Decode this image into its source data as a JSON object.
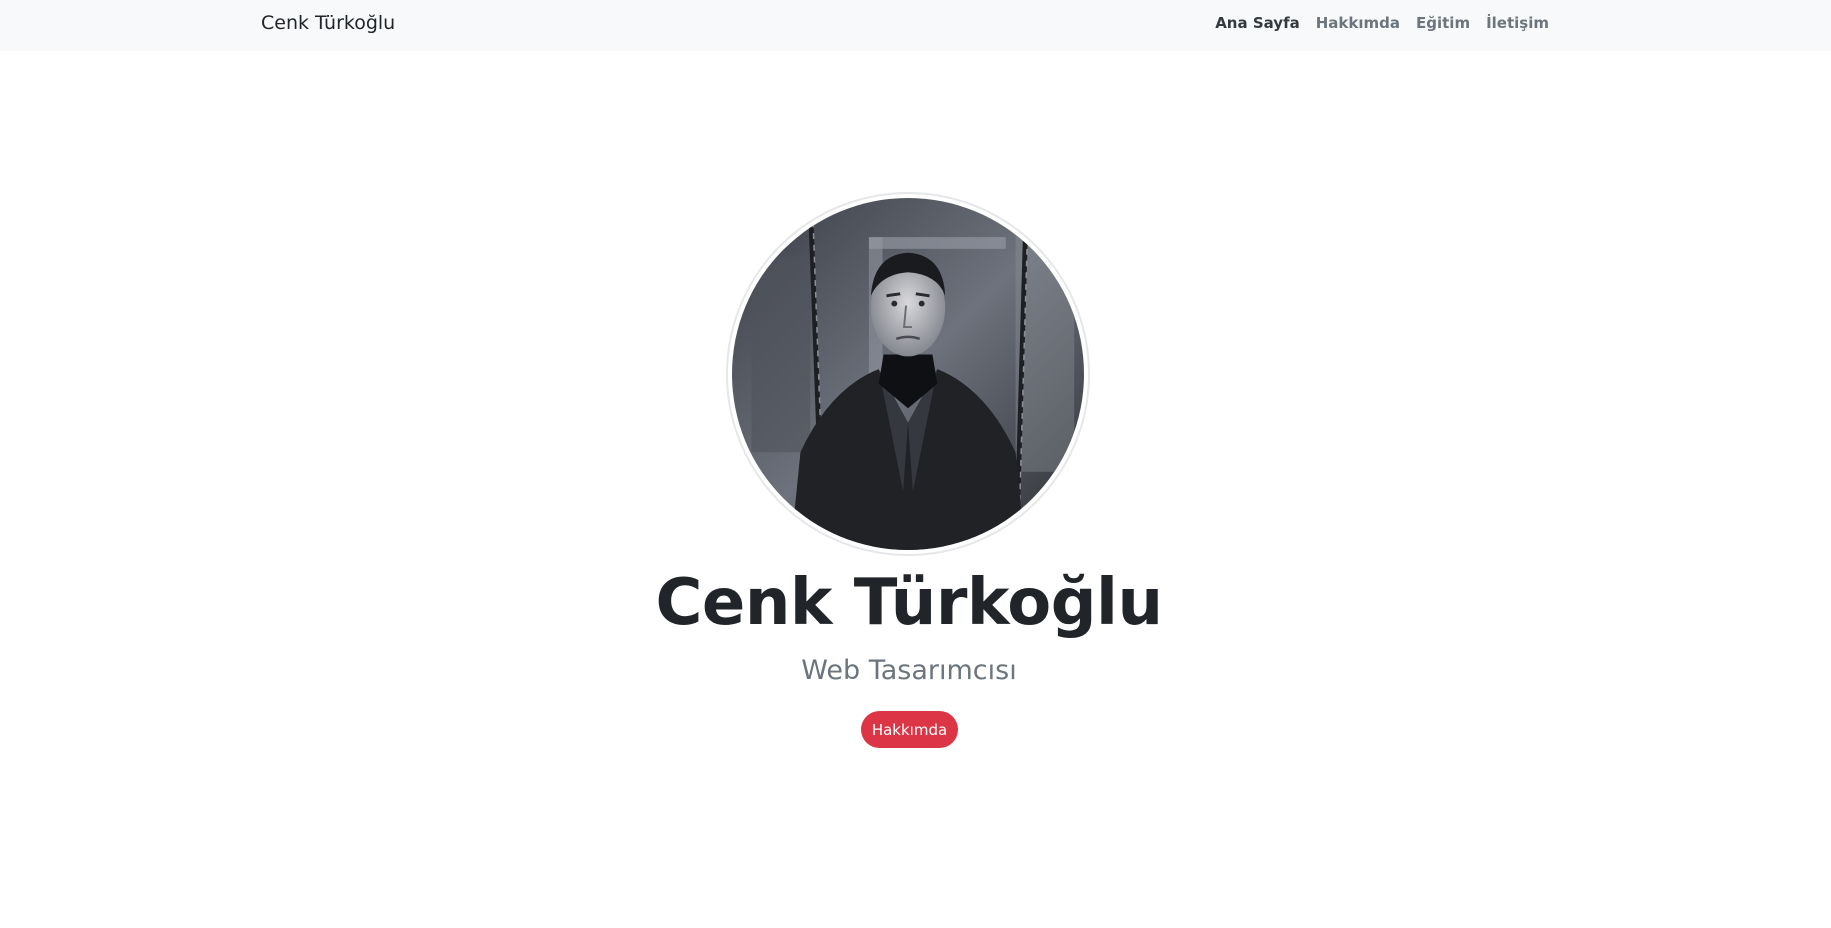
{
  "navbar": {
    "brand": "Cenk Türkoğlu",
    "links": [
      {
        "label": "Ana Sayfa",
        "active": true
      },
      {
        "label": "Hakkımda",
        "active": false
      },
      {
        "label": "Eğitim",
        "active": false
      },
      {
        "label": "İletişim",
        "active": false
      }
    ]
  },
  "hero": {
    "name": "Cenk Türkoğlu",
    "title": "Web Tasarımcısı",
    "button_label": "Hakkımda",
    "avatar_icon": "profile-photo"
  },
  "colors": {
    "navbar_bg": "#f8f9fa",
    "accent": "#dc3545",
    "text_dark": "#212529",
    "text_muted": "#6c757d"
  }
}
